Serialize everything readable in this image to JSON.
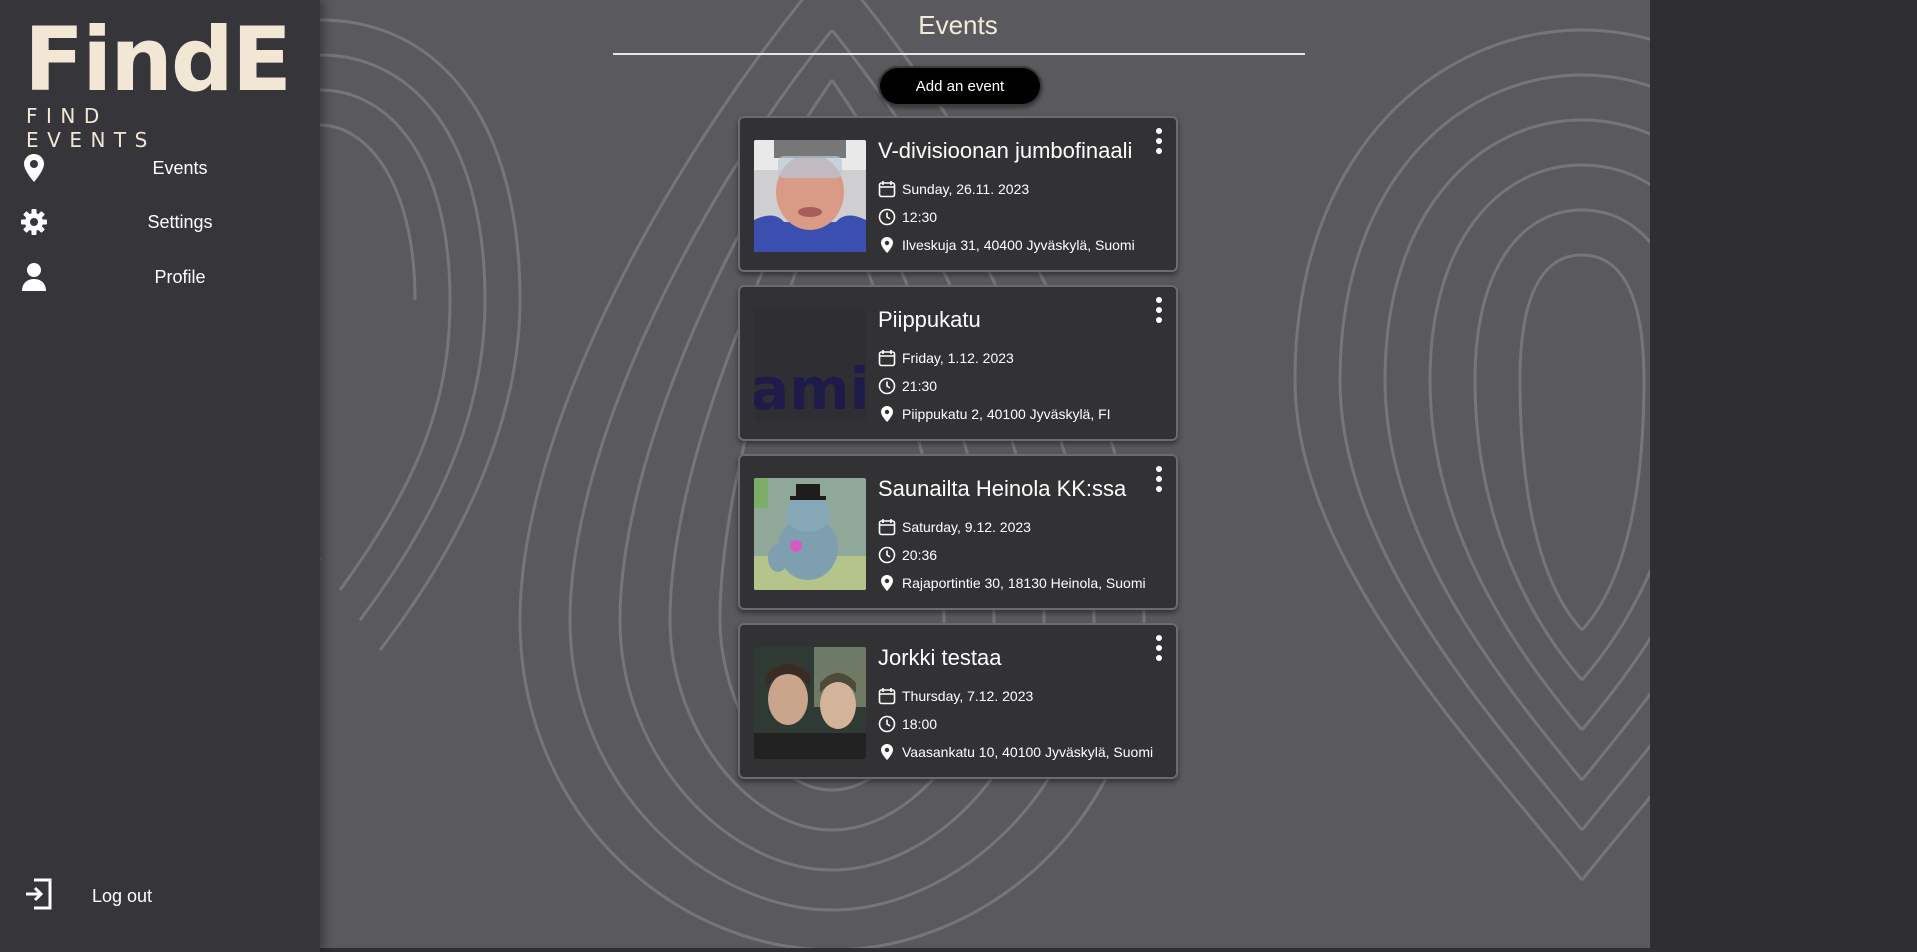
{
  "logo": {
    "wordmark": "FindE",
    "tagline": "FIND EVENTS"
  },
  "sidebar": {
    "items": [
      {
        "label": "Events",
        "icon": "map-pin-icon"
      },
      {
        "label": "Settings",
        "icon": "gear-icon"
      },
      {
        "label": "Profile",
        "icon": "user-icon"
      }
    ],
    "logout": {
      "label": "Log out",
      "icon": "logout-icon"
    }
  },
  "main": {
    "title": "Events",
    "add_button": "Add an event",
    "events": [
      {
        "title": "V-divisioonan jumbofinaali",
        "date": "Sunday, 26.11. 2023",
        "time": "12:30",
        "location": "Ilveskuja 31, 40400 Jyväskylä, Suomi"
      },
      {
        "title": "Piippukatu",
        "date": "Friday, 1.12. 2023",
        "time": "21:30",
        "location": "Piippukatu 2, 40100 Jyväskylä, FI"
      },
      {
        "title": "Saunailta Heinola KK:ssa",
        "date": "Saturday, 9.12. 2023",
        "time": "20:36",
        "location": "Rajaportintie 30, 18130 Heinola, Suomi"
      },
      {
        "title": "Jorkki testaa",
        "date": "Thursday, 7.12. 2023",
        "time": "18:00",
        "location": "Vaasankatu 10, 40100 Jyväskylä, Suomi"
      }
    ]
  },
  "colors": {
    "sidebar": "#36363a",
    "main_bg": "#5a5a5e",
    "card": "#323235",
    "logo": "#f2e6d4"
  }
}
